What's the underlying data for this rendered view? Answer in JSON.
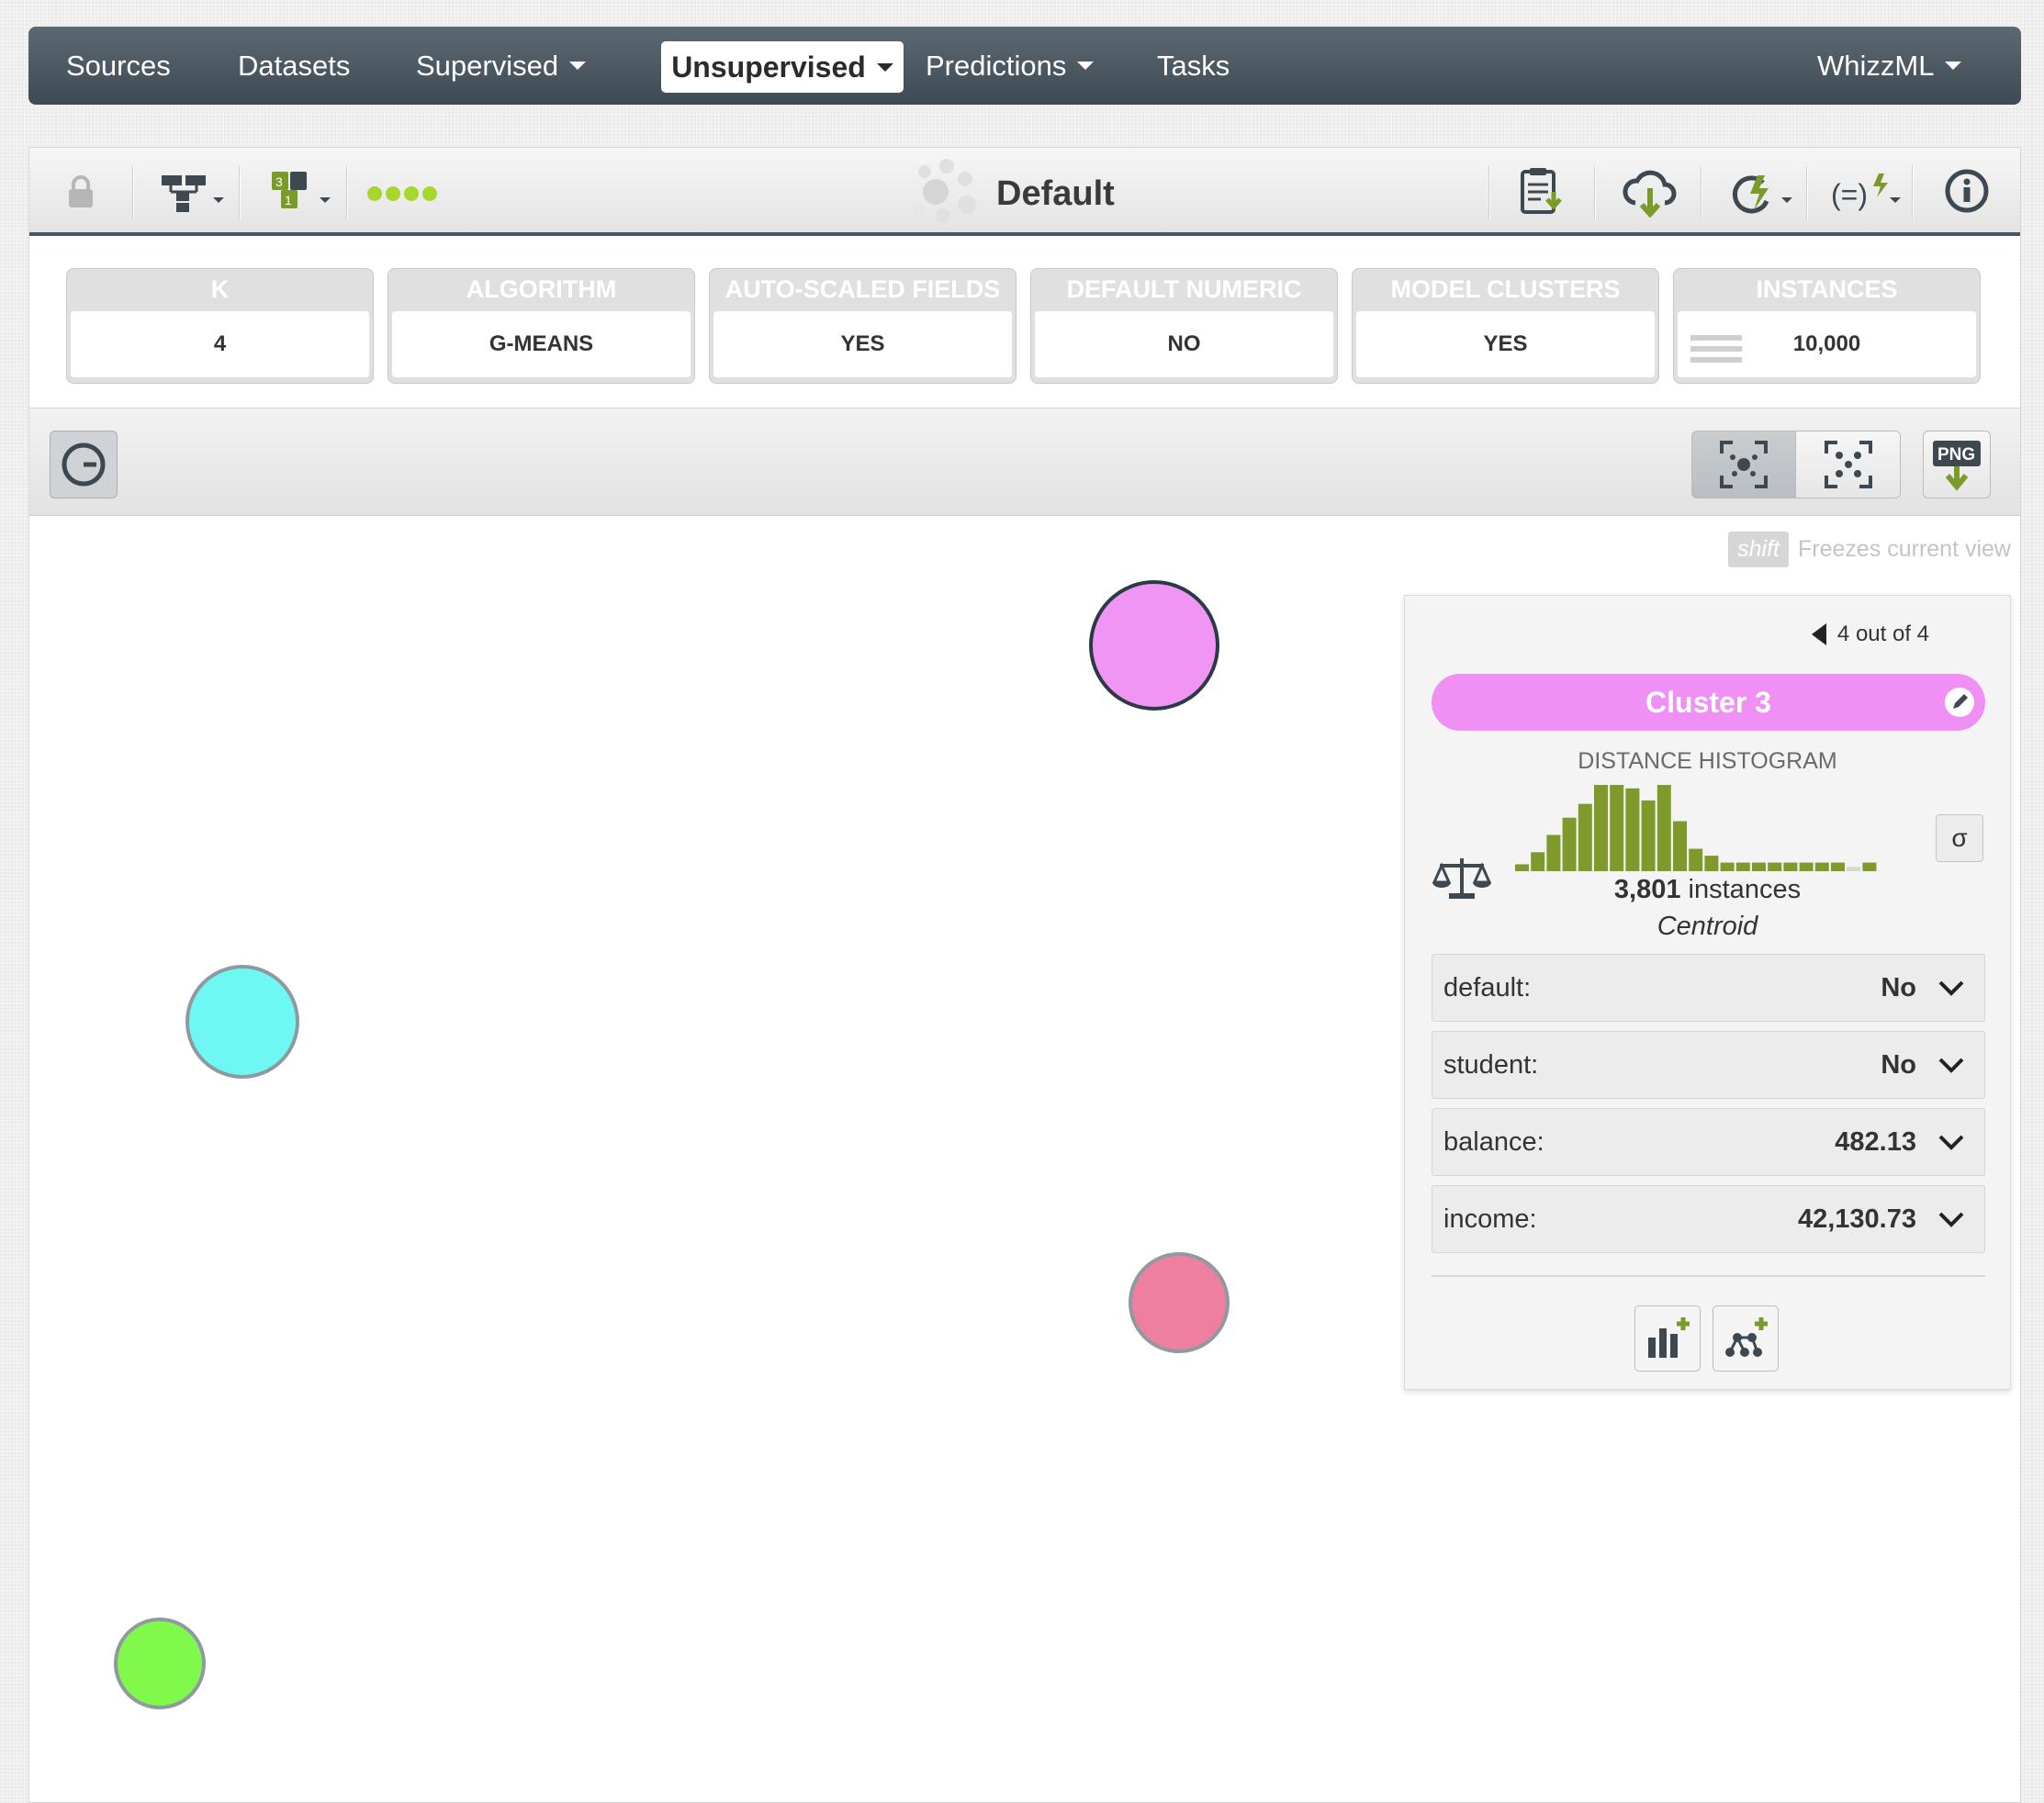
{
  "nav": {
    "sources": "Sources",
    "datasets": "Datasets",
    "supervised": "Supervised",
    "unsupervised": "Unsupervised",
    "predictions": "Predictions",
    "tasks": "Tasks",
    "whizzml": "WhizzML"
  },
  "toolbar": {
    "title": "Default"
  },
  "summary": [
    {
      "label": "K",
      "value": "4"
    },
    {
      "label": "ALGORITHM",
      "value": "G-MEANS"
    },
    {
      "label": "AUTO-SCALED FIELDS",
      "value": "YES"
    },
    {
      "label": "DEFAULT NUMERIC",
      "value": "NO"
    },
    {
      "label": "MODEL CLUSTERS",
      "value": "YES"
    },
    {
      "label": "INSTANCES",
      "value": "10,000"
    }
  ],
  "hint": {
    "key": "shift",
    "text": "Freezes current view"
  },
  "png_label": "PNG",
  "clusters_colors": {
    "cluster3": "#f095f4",
    "cyan": "#6ef8f4",
    "pink": "#ee7fa0",
    "green": "#80f94b"
  },
  "card": {
    "pager": "4 out of 4",
    "cluster_name": "Cluster 3",
    "cluster_color": "#f08ff4",
    "histogram_title": "DISTANCE HISTOGRAM",
    "histogram_values": [
      8,
      22,
      42,
      62,
      78,
      100,
      100,
      96,
      82,
      100,
      58,
      26,
      18,
      10,
      10,
      10,
      10,
      10,
      10,
      10,
      10,
      5,
      10
    ],
    "sigma": "σ",
    "instances_count": "3,801",
    "instances_label": " instances",
    "centroid": "Centroid",
    "fields": [
      {
        "name": "default:",
        "value": "No"
      },
      {
        "name": "student:",
        "value": "No"
      },
      {
        "name": "balance:",
        "value": "482.13"
      },
      {
        "name": "income:",
        "value": "42,130.73"
      }
    ]
  }
}
